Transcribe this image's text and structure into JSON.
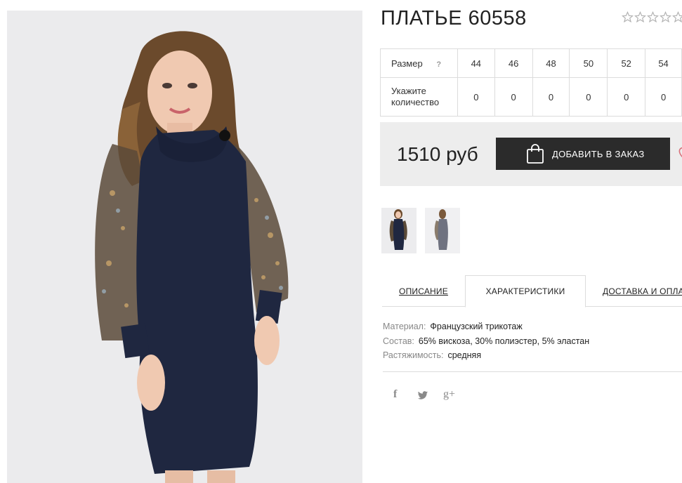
{
  "product": {
    "title": "ПЛАТЬЕ 60558",
    "rating_stars": 5
  },
  "size_table": {
    "size_label": "Размер",
    "help_mark": "?",
    "qty_label_line1": "Укажите",
    "qty_label_line2": "количество",
    "sizes": [
      "44",
      "46",
      "48",
      "50",
      "52",
      "54"
    ],
    "quantities": [
      "0",
      "0",
      "0",
      "0",
      "0",
      "0"
    ]
  },
  "purchase": {
    "price": "1510 руб",
    "order_button": "ДОБАВИТЬ В ЗАКАЗ"
  },
  "tabs": {
    "description": "ОПИСАНИЕ",
    "characteristics": "ХАРАКТЕРИСТИКИ",
    "delivery": "ДОСТАВКА И ОПЛАТА"
  },
  "specs": {
    "material_key": "Материал:",
    "material_val": "Французский трикотаж",
    "composition_key": "Состав:",
    "composition_val": "65% вискоза, 30% полиэстер, 5% эластан",
    "stretch_key": "Растяжимость:",
    "stretch_val": "средняя"
  },
  "social": {
    "facebook": "f",
    "google_plus": "g+"
  },
  "colors": {
    "dress": "#1f2740",
    "button": "#2b2b2b",
    "price_box": "#ededed"
  }
}
